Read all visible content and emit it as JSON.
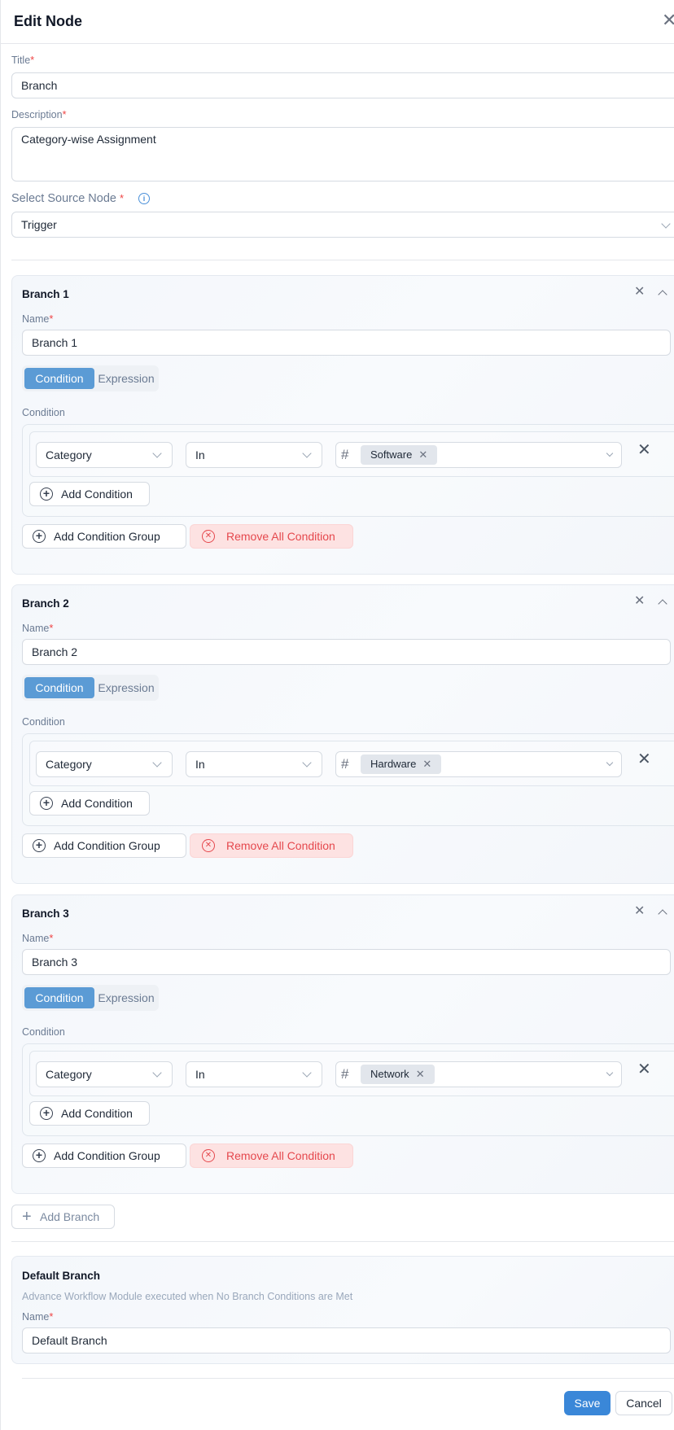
{
  "header": {
    "title": "Edit Node"
  },
  "form": {
    "title_label": "Title",
    "title_value": "Branch",
    "description_label": "Description",
    "description_value": "Category-wise Assignment",
    "source_label": "Select Source Node",
    "source_value": "Trigger"
  },
  "branches": [
    {
      "title": "Branch 1",
      "name_label": "Name",
      "name_value": "Branch 1",
      "tab_condition": "Condition",
      "tab_expression": "Expression",
      "condition_label": "Condition",
      "field": "Category",
      "operator": "In",
      "value_tag": "Software",
      "add_condition": "Add Condition",
      "add_group": "Add Condition Group",
      "remove_all": "Remove All Condition"
    },
    {
      "title": "Branch 2",
      "name_label": "Name",
      "name_value": "Branch 2",
      "tab_condition": "Condition",
      "tab_expression": "Expression",
      "condition_label": "Condition",
      "field": "Category",
      "operator": "In",
      "value_tag": "Hardware",
      "add_condition": "Add Condition",
      "add_group": "Add Condition Group",
      "remove_all": "Remove All Condition"
    },
    {
      "title": "Branch 3",
      "name_label": "Name",
      "name_value": "Branch 3",
      "tab_condition": "Condition",
      "tab_expression": "Expression",
      "condition_label": "Condition",
      "field": "Category",
      "operator": "In",
      "value_tag": "Network",
      "add_condition": "Add Condition",
      "add_group": "Add Condition Group",
      "remove_all": "Remove All Condition"
    }
  ],
  "add_branch": "Add Branch",
  "default_branch": {
    "title": "Default Branch",
    "subtitle": "Advance Workflow Module executed when No Branch Conditions are Met",
    "name_label": "Name",
    "name_value": "Default Branch"
  },
  "footer": {
    "save": "Save",
    "cancel": "Cancel"
  },
  "colors": {
    "primary": "#3a87d8",
    "segment_active": "#5b9bd5",
    "danger": "#e5484d",
    "danger_bg": "#fde2e2",
    "required": "#ef4444"
  }
}
